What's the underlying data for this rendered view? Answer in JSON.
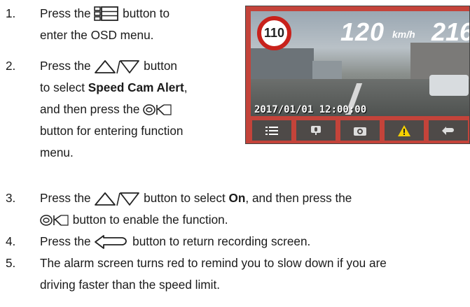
{
  "steps": [
    {
      "num": "1.",
      "l1a": "Press the",
      "l1b": "button to",
      "l2": "enter the OSD menu."
    },
    {
      "num": "2.",
      "l1a": "Press the",
      "l1b": "button",
      "l2a": "to select ",
      "l2b": "Speed Cam Alert",
      "l2c": ",",
      "l3a": "and then press the",
      "l4": "button for entering function",
      "l5": "menu."
    },
    {
      "num": "3.",
      "l1a": "Press the",
      "l1b": "button to select ",
      "l1c": "On",
      "l1d": ", and then press the",
      "l2": "button to enable the function."
    },
    {
      "num": "4.",
      "l1a": "Press the",
      "l1b": "button to return recording screen."
    },
    {
      "num": "5.",
      "l1": "The alarm screen turns red to remind you to slow down if you are",
      "l2": "driving faster than the speed limit."
    }
  ],
  "screen": {
    "speed_limit": "110",
    "speed": "120",
    "unit": "km/h",
    "heading": "216",
    "timestamp": "2017/01/01  12:00:00"
  },
  "icons": {
    "menu": "menu-icon",
    "up_down": "up-down-arrow-icon",
    "ok": "ok-icon",
    "return": "return-icon"
  },
  "colors": {
    "alert_red": "#c4433a",
    "sign_red": "#c8211b"
  }
}
